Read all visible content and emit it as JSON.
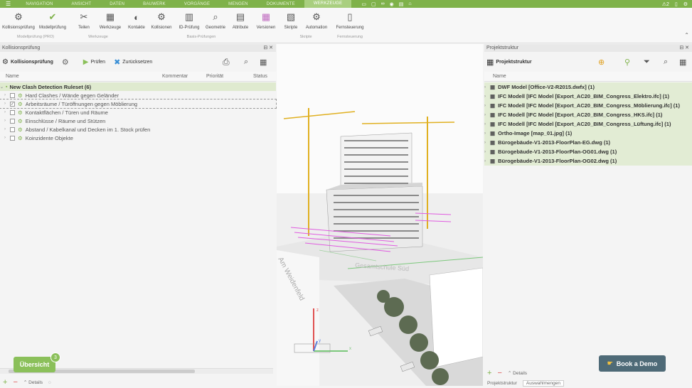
{
  "topbar": {
    "tabs": [
      "NAVIGATION",
      "ANSICHT",
      "DATEN",
      "BAUWERK",
      "VORGÄNGE",
      "MENGEN",
      "DOKUMENTE",
      "WERKZEUGE"
    ],
    "active_tab": "WERKZEUGE",
    "right_items": [
      "⚠2",
      "▯",
      "⚙"
    ]
  },
  "ribbon": {
    "buttons": [
      "Kollisionsprüfung",
      "Modellprüfung",
      "Teilen",
      "Werkzeuge",
      "Kontakte",
      "Kollisionen",
      "ID-Prüfung",
      "Geometrie",
      "Attribute",
      "Versionen",
      "Skripte",
      "Automation",
      "Fernsteuerung"
    ],
    "groups": [
      "Modellprüfung (PRO)",
      "Werkzeuge",
      "Basis-Prüfungen",
      "Skripte",
      "Fernsteuerung"
    ]
  },
  "left_panel": {
    "title": "Kollisionsprüfung",
    "toolbar_title": "Kollisionsprüfung",
    "check_label": "Prüfen",
    "reset_label": "Zurücksetzen",
    "columns": [
      "Name",
      "Kommentar",
      "Priorität",
      "Status"
    ],
    "ruleset": "New Clash Detection Ruleset (6)",
    "rules": [
      {
        "label": "Hard Clashes / Wände gegen Geländer",
        "checked": false
      },
      {
        "label": "Arbeitsräume / Türöffnungen gegen Möblierung",
        "checked": true
      },
      {
        "label": "Kontaktflächen / Türen und Räume",
        "checked": false
      },
      {
        "label": "Einschlüsse / Räume und Stützen",
        "checked": false
      },
      {
        "label": "Abstand / Kabelkanal und Decken im 1. Stock prüfen",
        "checked": false
      },
      {
        "label": "Koinzidente Objekte",
        "checked": false
      }
    ],
    "footer_details": "Details"
  },
  "viewer": {
    "street_label_1": "Gesamtschule Süd",
    "street_label_2": "Am Weidenfeld",
    "axis_z": "z",
    "axis_y": "y",
    "axis_x": "x"
  },
  "right_panel": {
    "title": "Projektstruktur",
    "toolbar_title": "Projektstruktur",
    "column": "Name",
    "items": [
      "DWF Model [Office-V2-R2015.dwfx] (1)",
      "IFC Modell [IFC Model [Export_AC20_BIM_Congress_Elektro.ifc] (1)",
      "IFC Modell [IFC Model [Export_AC20_BIM_Congress_Möblierung.ifc] (1)",
      "IFC Modell [IFC Model [Export_AC20_BIM_Congress_HKS.ifc] (1)",
      "IFC Modell [IFC Model [Export_AC20_BIM_Congress_Lüftung.ifc] (1)",
      "Ortho-Image [map_01.jpg] (1)",
      "Bürogebäude-V1-2013-FloorPlan-EG.dwg (1)",
      "Bürogebäude-V1-2013-FloorPlan-OG01.dwg (1)",
      "Bürogebäude-V1-2013-FloorPlan-OG02.dwg (1)"
    ],
    "footer_details": "Details",
    "footer_tab": "Projektstruktur",
    "footer_tab2": "Auswahlmengen"
  },
  "overview_button": "Übersicht",
  "overview_badge": "3",
  "demo_button": "Book a Demo"
}
